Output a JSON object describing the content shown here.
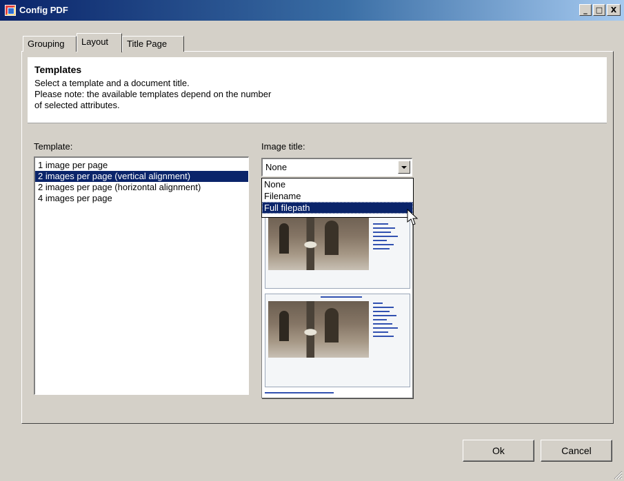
{
  "window": {
    "title": "Config PDF",
    "controls": {
      "minimize": "_",
      "maximize": "□",
      "close": "X"
    }
  },
  "tabs": [
    {
      "label": "Grouping",
      "active": false
    },
    {
      "label": "Layout",
      "active": true
    },
    {
      "label": "Title Page",
      "active": false
    }
  ],
  "header": {
    "title": "Templates",
    "lines": [
      "Select a template and a document title.",
      "Please note: the available templates depend on the number",
      "of selected attributes."
    ]
  },
  "template": {
    "label": "Template:",
    "items": [
      "1 image per page",
      "2 images per page (vertical alignment)",
      "2 images per page (horizontal alignment)",
      "4 images per page"
    ],
    "selected_index": 1
  },
  "image_title": {
    "label": "Image title:",
    "value": "None",
    "options": [
      "None",
      "Filename",
      "Full filepath"
    ],
    "highlighted_index": 2
  },
  "buttons": {
    "ok": "Ok",
    "cancel": "Cancel"
  },
  "colors": {
    "selection": "#0a246a",
    "face": "#d4d0c8",
    "titlebar_start": "#0a246a",
    "titlebar_end": "#a6caf0"
  },
  "icons": [
    "app-icon",
    "dropdown-arrow-icon",
    "pointer-cursor-icon",
    "resize-grip-icon"
  ]
}
